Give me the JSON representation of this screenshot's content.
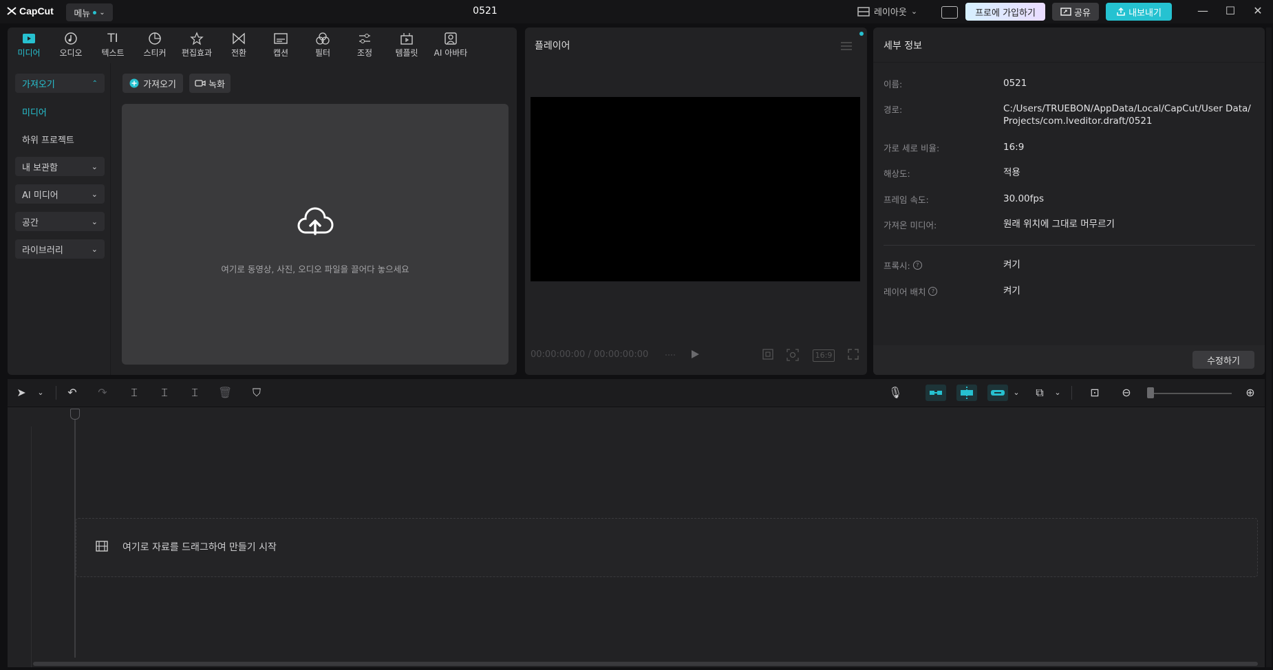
{
  "app": {
    "logo": "CapCut",
    "menu_label": "메뉴",
    "project_title": "0521"
  },
  "titlebar": {
    "layout_label": "레이아웃",
    "pro_label": "프로에 가입하기",
    "share_label": "공유",
    "export_label": "내보내기"
  },
  "tabs": [
    {
      "label": "미디어",
      "icon": "media-icon"
    },
    {
      "label": "오디오",
      "icon": "audio-icon"
    },
    {
      "label": "텍스트",
      "icon": "text-icon"
    },
    {
      "label": "스티커",
      "icon": "sticker-icon"
    },
    {
      "label": "편집효과",
      "icon": "effects-icon"
    },
    {
      "label": "전환",
      "icon": "transition-icon"
    },
    {
      "label": "캡션",
      "icon": "caption-icon"
    },
    {
      "label": "필터",
      "icon": "filter-icon"
    },
    {
      "label": "조정",
      "icon": "adjust-icon"
    },
    {
      "label": "템플릿",
      "icon": "template-icon"
    },
    {
      "label": "AI 아바타",
      "icon": "ai-avatar-icon"
    }
  ],
  "sidebar": {
    "import": "가져오기",
    "media": "미디어",
    "subproject": "하위 프로젝트",
    "my_storage": "내 보관함",
    "ai_media": "AI 미디어",
    "space": "공간",
    "library": "라이브러리"
  },
  "media": {
    "import_button": "가져오기",
    "record_button": "녹화",
    "drop_text": "여기로 동영상, 사진, 오디오 파일을 끌어다 놓으세요"
  },
  "player": {
    "title": "플레이어",
    "timecode": "00:00:00:00 / 00:00:00:00",
    "ratio": "16:9"
  },
  "details": {
    "title": "세부 정보",
    "name_label": "이름:",
    "name_value": "0521",
    "path_label": "경로:",
    "path_value_1": "C:/Users/TRUEBON/AppData/Local/CapCut/User Data/",
    "path_value_2": "Projects/com.lveditor.draft/0521",
    "ratio_label": "가로 세로 비율:",
    "ratio_value": "16:9",
    "resolution_label": "해상도:",
    "resolution_value": "적용",
    "fps_label": "프레임 속도:",
    "fps_value": "30.00fps",
    "imported_label": "가져온 미디어:",
    "imported_value": "원래 위치에 그대로 머무르기",
    "proxy_label": "프록시:",
    "proxy_value": "켜기",
    "layer_label": "레이어 배치",
    "layer_value": "켜기",
    "edit_button": "수정하기"
  },
  "timeline": {
    "drop_text": "여기로 자료를 드래그하여 만들기 시작"
  },
  "colors": {
    "accent": "#27c1d0",
    "panel": "#222224",
    "background": "#101012"
  }
}
